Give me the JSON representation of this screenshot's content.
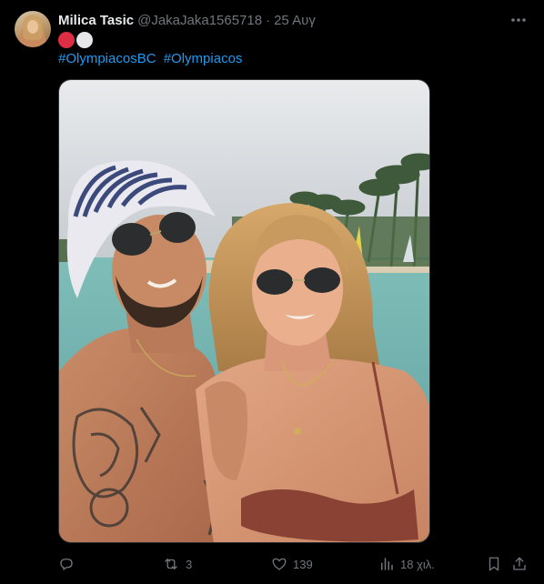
{
  "tweet": {
    "display_name": "Milica Tasic",
    "handle": "@JakaJaka1565718",
    "separator": "·",
    "date": "25 Αυγ",
    "emojis": [
      {
        "name": "red-circle-emoji",
        "color": "#dd2e44"
      },
      {
        "name": "white-circle-emoji",
        "color": "#e6e7e8"
      }
    ],
    "hashtags": [
      "#OlympiacosBC",
      "#Olympiacos"
    ]
  },
  "actions": {
    "reply": {
      "icon": "reply-icon",
      "count": ""
    },
    "retweet": {
      "icon": "retweet-icon",
      "count": "3"
    },
    "like": {
      "icon": "heart-icon",
      "count": "139"
    },
    "views": {
      "icon": "views-icon",
      "count": "18 χιλ."
    },
    "bookmark": {
      "icon": "bookmark-icon"
    },
    "share": {
      "icon": "share-icon"
    }
  },
  "colors": {
    "background": "#000000",
    "text_primary": "#e7e9ea",
    "text_secondary": "#71767b",
    "link": "#1d9bf0",
    "border": "#2f3336"
  }
}
